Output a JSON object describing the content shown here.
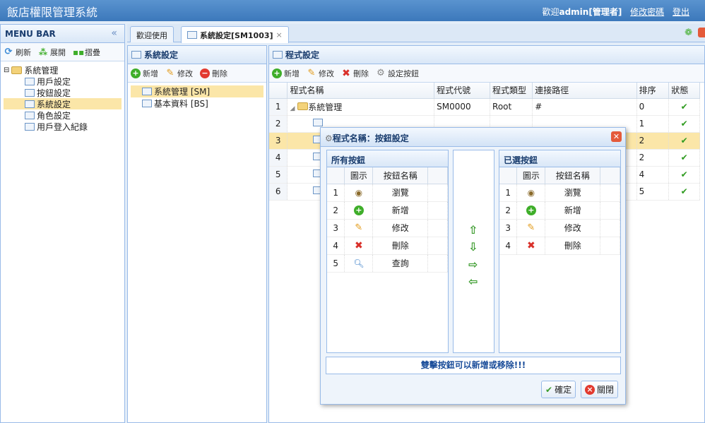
{
  "app": {
    "title": "飯店權限管理系統",
    "welcome_prefix": "歡迎",
    "user": "admin[管理者]",
    "change_password": "修改密碼",
    "logout": "登出"
  },
  "menu": {
    "title": "MENU BAR",
    "collapse_icon": "«",
    "refresh": "刷新",
    "expand": "展開",
    "collapse": "摺疊",
    "tree": {
      "root": "系統管理",
      "children": [
        "用戶設定",
        "按鈕設定",
        "系統設定",
        "角色設定",
        "用戶登入紀錄"
      ]
    }
  },
  "tabs": [
    {
      "label": "歡迎使用"
    },
    {
      "label": "系統設定[SM1003]",
      "close": "×"
    }
  ],
  "system_panel": {
    "title": "系統設定",
    "add": "新增",
    "edit": "修改",
    "delete": "刪除",
    "items": [
      "系統管理 [SM]",
      "基本資料 [BS]"
    ]
  },
  "program_panel": {
    "title": "程式設定",
    "add": "新增",
    "edit": "修改",
    "delete": "刪除",
    "set_buttons": "設定按鈕",
    "columns": [
      "程式名稱",
      "程式代號",
      "程式類型",
      "連接路徑",
      "排序",
      "狀態"
    ],
    "rows": [
      {
        "n": "1",
        "name": "系統管理",
        "code": "SM0000",
        "type": "Root",
        "path": "#",
        "order": "0"
      },
      {
        "n": "2",
        "order": "1"
      },
      {
        "n": "3",
        "order": "2"
      },
      {
        "n": "4",
        "order": "2"
      },
      {
        "n": "5",
        "order": "4"
      },
      {
        "n": "6",
        "order": "5"
      }
    ]
  },
  "dialog": {
    "title": "程式名稱：按鈕設定",
    "all_title": "所有按鈕",
    "selected_title": "已選按鈕",
    "col_icon": "圖示",
    "col_name": "按鈕名稱",
    "all": [
      {
        "n": "1",
        "icon": "eye-icon",
        "name": "瀏覽"
      },
      {
        "n": "2",
        "icon": "add-icon",
        "name": "新增"
      },
      {
        "n": "3",
        "icon": "pencil-icon",
        "name": "修改"
      },
      {
        "n": "4",
        "icon": "delete-icon",
        "name": "刪除"
      },
      {
        "n": "5",
        "icon": "search-icon",
        "name": "查詢"
      }
    ],
    "selected": [
      {
        "n": "1",
        "icon": "eye-icon",
        "name": "瀏覽"
      },
      {
        "n": "2",
        "icon": "add-icon",
        "name": "新增"
      },
      {
        "n": "3",
        "icon": "pencil-icon",
        "name": "修改"
      },
      {
        "n": "4",
        "icon": "delete-icon",
        "name": "刪除"
      }
    ],
    "hint": "雙擊按鈕可以新增或移除!!!",
    "ok": "確定",
    "close": "關閉"
  }
}
